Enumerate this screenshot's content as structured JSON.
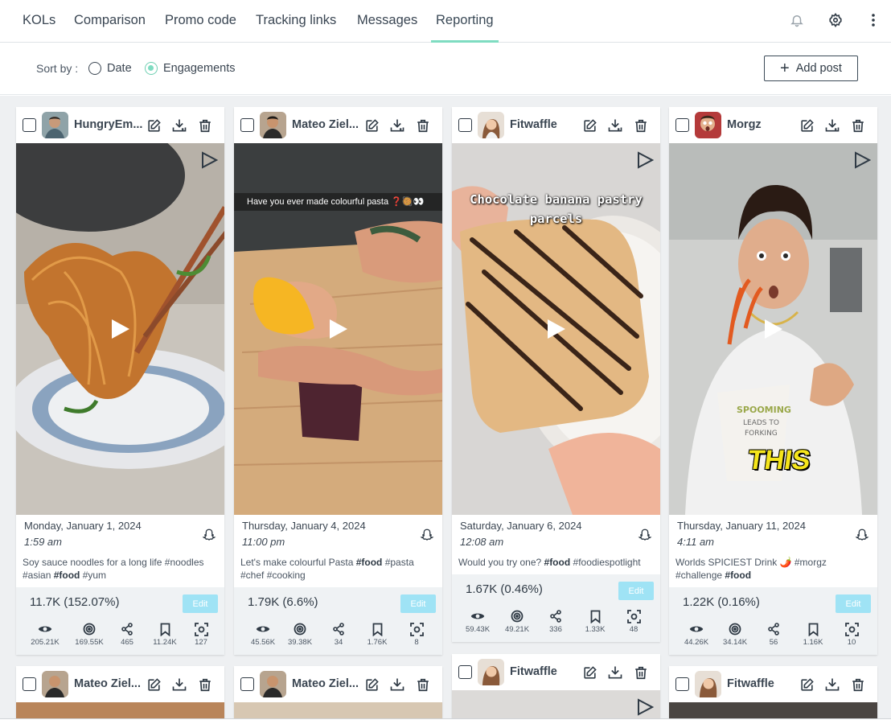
{
  "nav": {
    "tabs": [
      {
        "label": "KOLs"
      },
      {
        "label": "Comparison"
      },
      {
        "label": "Promo code"
      },
      {
        "label": "Tracking links"
      },
      {
        "label": "Messages"
      },
      {
        "label": "Reporting"
      }
    ],
    "active_tab": "Reporting",
    "icons": [
      "bell-icon",
      "gear-icon",
      "more-vertical-icon"
    ]
  },
  "sort": {
    "label": "Sort by :",
    "options": [
      {
        "label": "Date",
        "selected": false
      },
      {
        "label": "Engagements",
        "selected": true
      }
    ]
  },
  "add_post": {
    "label": "Add post"
  },
  "colors": {
    "accent": "#7fdcc1",
    "edit_button": "#9fe3f5",
    "grid_bg": "#eef0f2"
  },
  "posts": [
    {
      "name": "HungryEm...",
      "date": "Monday, January 1, 2024",
      "time": "1:59 am",
      "caption_html": "Soy sauce noodles for a long life #noodles #asian <b>#food</b> #yum",
      "engagement": "11.7K (152.07%)",
      "edit_label": "Edit",
      "metrics": [
        "205.21K",
        "169.55K",
        "465",
        "11.24K",
        "127"
      ],
      "overlay_text": ""
    },
    {
      "name": "Mateo Ziel...",
      "date": "Thursday, January 4, 2024",
      "time": "11:00 pm",
      "caption_html": "Let's make colourful Pasta <b>#food</b> #pasta #chef #cooking",
      "engagement": "1.79K (6.6%)",
      "edit_label": "Edit",
      "metrics": [
        "45.56K",
        "39.38K",
        "34",
        "1.76K",
        "8"
      ],
      "overlay_text": "Have you ever made colourful pasta ❓🥘👀"
    },
    {
      "name": "Fitwaffle",
      "date": "Saturday, January 6, 2024",
      "time": "12:08 am",
      "caption_html": "Would you try one? <b>#food</b> #foodiespotlight",
      "engagement": "1.67K (0.46%)",
      "edit_label": "Edit",
      "metrics": [
        "59.43K",
        "49.21K",
        "336",
        "1.33K",
        "48"
      ],
      "overlay_text": "Chocolate banana pastry parcels"
    },
    {
      "name": "Morgz",
      "date": "Thursday, January 11, 2024",
      "time": "4:11 am",
      "caption_html": "Worlds SPICIEST Drink 🌶️ #morgz #challenge <b>#food</b>",
      "engagement": "1.22K (0.16%)",
      "edit_label": "Edit",
      "metrics": [
        "44.26K",
        "34.14K",
        "56",
        "1.16K",
        "10"
      ],
      "overlay_text": "THIS"
    },
    {
      "name": "Mateo Ziel..."
    },
    {
      "name": "Mateo Ziel..."
    },
    {
      "name": "Fitwaffle"
    },
    {
      "name": "Fitwaffle"
    }
  ],
  "metric_icons": [
    "eye-icon",
    "reach-icon",
    "share-icon",
    "bookmark-icon",
    "screenshot-icon"
  ]
}
